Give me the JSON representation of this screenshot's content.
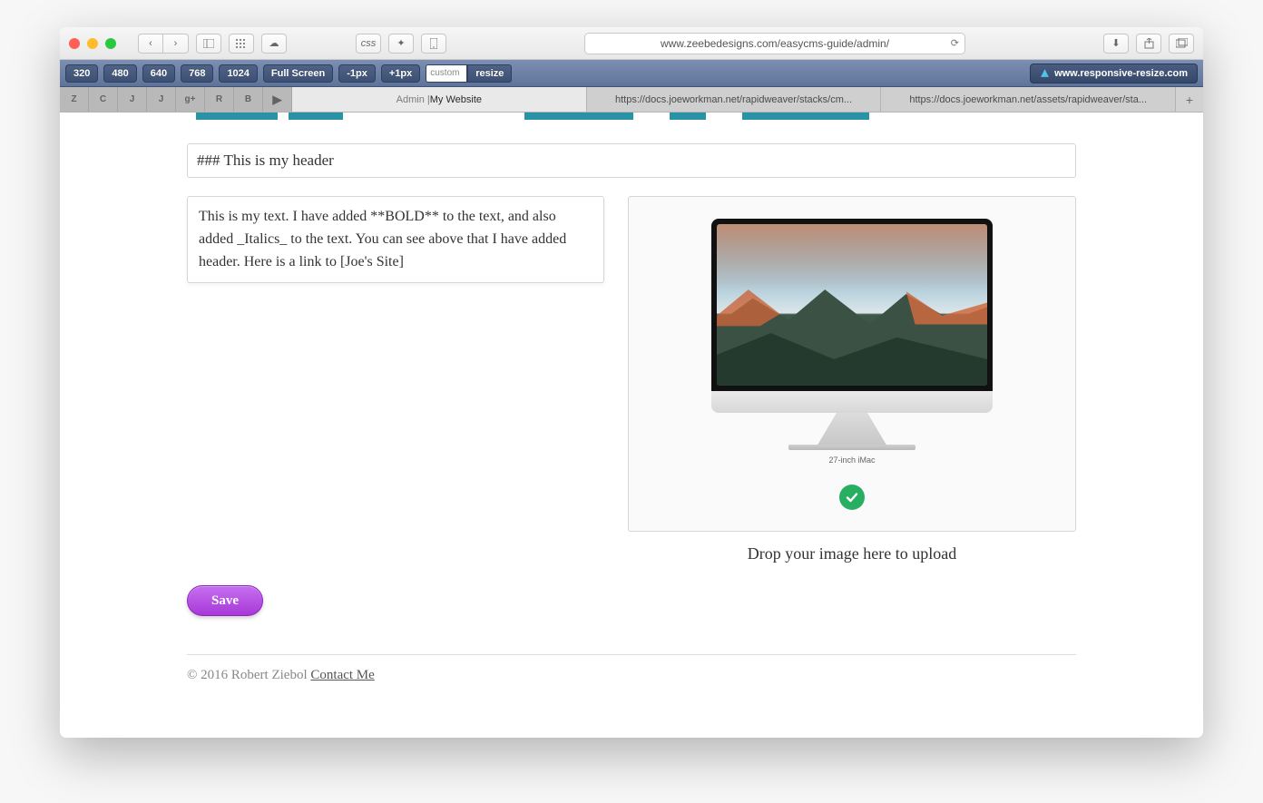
{
  "browser": {
    "url": "www.zeebedesigns.com/easycms-guide/admin/",
    "toolbar": {
      "sizes": [
        "320",
        "480",
        "640",
        "768",
        "1024"
      ],
      "full_screen": "Full Screen",
      "minus": "-1px",
      "plus": "+1px",
      "custom_placeholder": "custom",
      "resize": "resize",
      "brand": "www.responsive-resize.com"
    },
    "favorites": [
      "Z",
      "C",
      "J",
      "J",
      "g+",
      "R",
      "B",
      "▶"
    ],
    "tabs": [
      {
        "pre": "Admin | ",
        "title": "My Website",
        "active": true
      },
      {
        "pre": "",
        "title": "https://docs.joeworkman.net/rapidweaver/stacks/cm...",
        "active": false
      },
      {
        "pre": "",
        "title": "https://docs.joeworkman.net/assets/rapidweaver/sta...",
        "active": false
      }
    ]
  },
  "cms": {
    "header_value": "### This is my header",
    "body_value": "This is my text. I have added **BOLD** to the text, and also added _Italics_ to the text. You can see above that I have added header. Here is a link to [Joe's Site]",
    "image_caption": "27-inch iMac",
    "drop_label": "Drop your image here to upload",
    "save_label": "Save"
  },
  "footer": {
    "copyright": "© 2016 Robert Ziebol ",
    "contact": "Contact Me"
  }
}
